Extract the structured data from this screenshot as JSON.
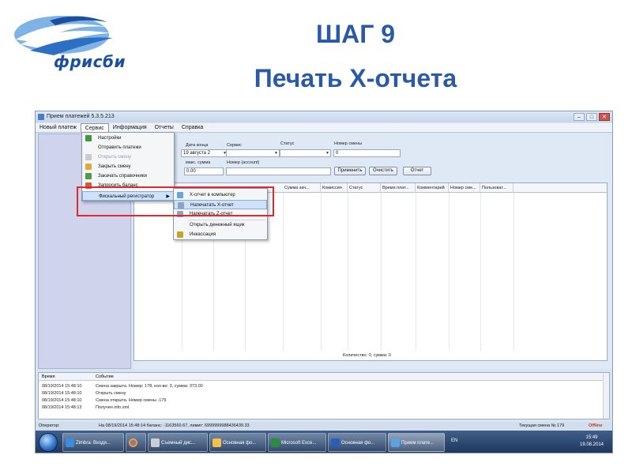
{
  "logo": {
    "text": "фрисби"
  },
  "slide": {
    "title_line1": "ШАГ 9",
    "title_line2": "Печать Х-отчета"
  },
  "window": {
    "title": "Прием платежей 5.3.5.213",
    "buttons": [
      "–",
      "□",
      "✕"
    ]
  },
  "menubar": [
    "Новый платеж",
    "Сервис",
    "Информация",
    "Отчеты",
    "Справка"
  ],
  "service_menu": [
    {
      "label": "Настройки",
      "icon": "settings-icon",
      "disabled": false
    },
    {
      "label": "Отправить платежи",
      "icon": "",
      "disabled": false
    },
    {
      "label": "Открыть смену",
      "icon": "open-shift-icon",
      "disabled": true
    },
    {
      "label": "Закрыть смену",
      "icon": "close-shift-icon",
      "disabled": false
    },
    {
      "label": "Закачать справочники",
      "icon": "download-icon",
      "disabled": false
    },
    {
      "label": "Запросить баланс",
      "icon": "balance-icon",
      "disabled": false
    },
    {
      "label": "Фискальный регистратор",
      "icon": "",
      "disabled": false,
      "submenu": true
    }
  ],
  "fiscal_submenu": [
    {
      "label": "X-отчет в компьютер",
      "icon": "report-computer-icon"
    },
    {
      "label": "Напечатать X-отчет",
      "icon": "print-icon"
    },
    {
      "label": "Напечатать Z-отчет",
      "icon": "print-z-icon"
    },
    {
      "label": "Открыть денежный ящик",
      "icon": ""
    },
    {
      "label": "Инкассация",
      "icon": "collection-icon"
    }
  ],
  "filters": {
    "date_end_label": "Дата конца",
    "date_end_value": "19 августа 2",
    "service_label": "Сервис",
    "status_label": "Статус",
    "shift_label": "Номер смены",
    "shift_value": "0",
    "max_sum_label": "макс. сумма",
    "max_sum_value": "0.00",
    "account_label": "Номер (account)",
    "apply_button": "Применить",
    "clear_button": "Очистить",
    "report_button": "Отчет"
  },
  "grid": {
    "columns": [
      "Сумма зач...",
      "Комиссия",
      "Статус",
      "Время плат...",
      "Комментарий",
      "Номер сме...",
      "Пользоват..."
    ],
    "footer": "Количество: 0, сумма: 0"
  },
  "log": {
    "headers": [
      "Время",
      "Событие"
    ],
    "rows": [
      {
        "time": "08/19/2014 15:48:10",
        "event": "Смена закрыта. Номер: 178, кол-во: 3, сумма: 373.00"
      },
      {
        "time": "08/19/2014 15:48:10",
        "event": "Открыть смену"
      },
      {
        "time": "08/19/2014 15:48:10",
        "event": "Смена открыта. Номер смены -179"
      },
      {
        "time": "08/19/2014 15:48:13",
        "event": "Получен info.xml"
      }
    ]
  },
  "statusbar": {
    "operator": "Оператор:",
    "balance": "На 08/19/2014 15:48:14 баланс: -1163560.67, лимит: 6999999988436439.33",
    "shift": "Текущая смена № 179",
    "mode": "Offline"
  },
  "taskbar": {
    "items": [
      "Zimbra: Входя...",
      "",
      "Съемный дис...",
      "Основная фо...",
      "Microsoft Exce...",
      "Основная фо...",
      "Прием плате..."
    ],
    "lang": "EN",
    "time": "15:49",
    "date": "19.08.2014"
  },
  "colors": {
    "title": "#2a5aa6",
    "highlight_box": "#e0282f",
    "menu_highlight": "#cfe1fb"
  }
}
